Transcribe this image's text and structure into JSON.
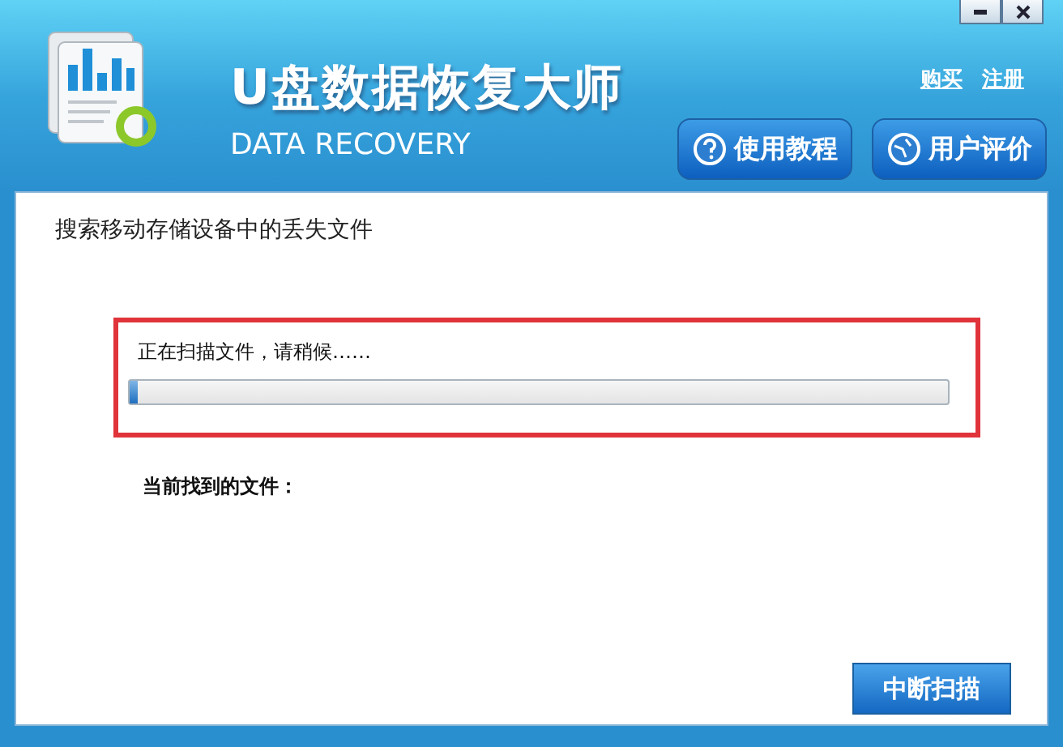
{
  "header": {
    "title": "U盘数据恢复大师",
    "subtitle": "DATA RECOVERY",
    "links": [
      "购买",
      "注册"
    ],
    "buttons": [
      {
        "label": "使用教程",
        "kind": "help"
      },
      {
        "label": "用户评价",
        "kind": "review"
      }
    ]
  },
  "section_title": "搜索移动存储设备中的丢失文件",
  "scan": {
    "status": "正在扫描文件，请稍候……",
    "level": 0.01
  },
  "found_label": "当前找到的文件：",
  "stop_button": "中断扫描"
}
